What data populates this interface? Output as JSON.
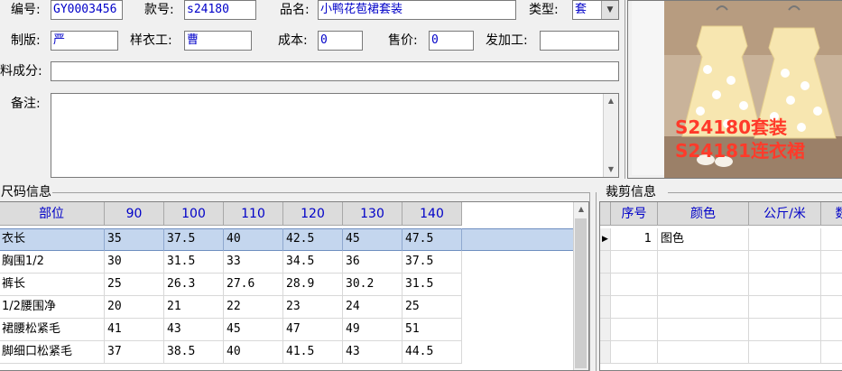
{
  "form": {
    "code_label": "编号:",
    "code_value": "GY0003456",
    "style_label": "款号:",
    "style_value": "s24180",
    "name_label": "品名:",
    "name_value": "小鸭花苞裙套装",
    "type_label": "类型:",
    "type_value": "套",
    "pattern_label": "制版:",
    "pattern_value": "严",
    "sample_label": "样衣工:",
    "sample_value": "曹",
    "cost_label": "成本:",
    "cost_value": "0",
    "price_label": "售价:",
    "price_value": "0",
    "processor_label": "发加工:",
    "processor_value": "",
    "fabric_label": "料成分:",
    "fabric_value": "",
    "remark_label": "备注:",
    "remark_value": ""
  },
  "photo": {
    "caption_line1": "S24180套装",
    "caption_line2": "S24181连衣裙",
    "colors": {
      "caption": "#ff3a2a",
      "dress": "#f7e6b0",
      "background": "#c9b39a"
    }
  },
  "size_section": {
    "title": "尺码信息",
    "headers": [
      "部位",
      "90",
      "100",
      "110",
      "120",
      "130",
      "140"
    ],
    "rows": [
      [
        "衣长",
        "35",
        "37.5",
        "40",
        "42.5",
        "45",
        "47.5"
      ],
      [
        "胸围1/2",
        "30",
        "31.5",
        "33",
        "34.5",
        "36",
        "37.5"
      ],
      [
        "裤长",
        "25",
        "26.3",
        "27.6",
        "28.9",
        "30.2",
        "31.5"
      ],
      [
        "1/2腰围净",
        "20",
        "21",
        "22",
        "23",
        "24",
        "25"
      ],
      [
        "裙腰松紧毛",
        "41",
        "43",
        "45",
        "47",
        "49",
        "51"
      ],
      [
        "脚细口松紧毛",
        "37",
        "38.5",
        "40",
        "41.5",
        "43",
        "44.5"
      ]
    ]
  },
  "cut_section": {
    "title": "裁剪信息",
    "headers": [
      "序号",
      "颜色",
      "公斤/米",
      "数量"
    ],
    "rows": [
      [
        "1",
        "图色",
        "",
        ""
      ]
    ]
  },
  "theme": {
    "header_text": "#0000c8",
    "selection": "#c4d6ee"
  }
}
